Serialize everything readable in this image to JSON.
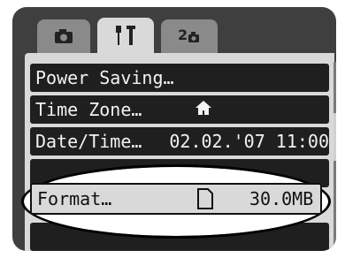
{
  "tabs": [
    {
      "icon": "camera-icon",
      "active": false
    },
    {
      "icon": "tools-icon",
      "active": true
    },
    {
      "icon": "my-menu-icon",
      "active": false
    }
  ],
  "menu": {
    "power_saving": "Power Saving…",
    "time_zone": "Time Zone…",
    "date_time": "Date/Time…",
    "date_time_value": "02.02.'07 11:00",
    "format": "Format…",
    "format_value": "30.0MB"
  },
  "colors": {
    "panel": "#3f3f3f",
    "row": "#1f1f1f",
    "selected": "#d9d9d9"
  }
}
